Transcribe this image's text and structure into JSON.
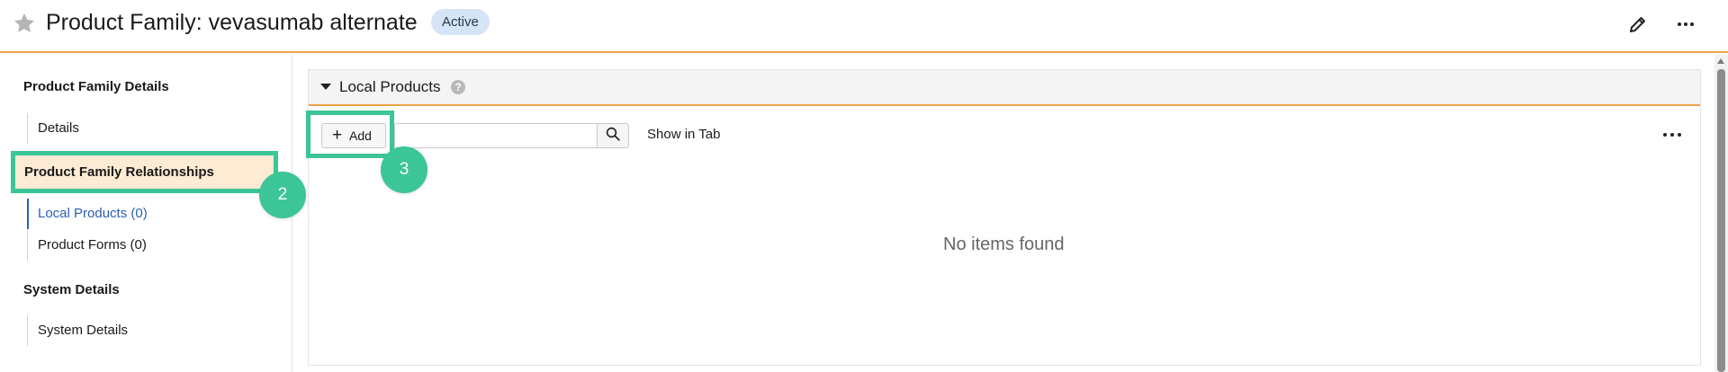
{
  "header": {
    "title": "Product Family: vevasumab alternate",
    "status": "Active",
    "favorite_icon": "star-icon",
    "edit_icon": "pencil-icon",
    "more_icon": "more-horizontal-icon"
  },
  "sidebar": {
    "sections": [
      {
        "heading": "Product Family Details",
        "items": [
          "Details"
        ]
      },
      {
        "heading": "Product Family Relationships",
        "items": [
          "Local Products (0)",
          "Product Forms (0)"
        ]
      },
      {
        "heading": "System Details",
        "items": [
          "System Details"
        ]
      }
    ],
    "active_item": "Local Products (0)"
  },
  "steps": {
    "step2": "2",
    "step3": "3"
  },
  "panel": {
    "title": "Local Products",
    "help_icon": "?",
    "add_label": "Add",
    "add_icon": "+",
    "search_placeholder": "",
    "search_icon": "search-icon",
    "show_in_tab": "Show in Tab",
    "empty_message": "No items found"
  },
  "colors": {
    "accent_orange": "#f0a34a",
    "highlight_green": "#3cc596",
    "active_blue": "#2b5fb3",
    "badge_bg": "#d6e4f7",
    "highlight_fill": "#fdebd4"
  }
}
